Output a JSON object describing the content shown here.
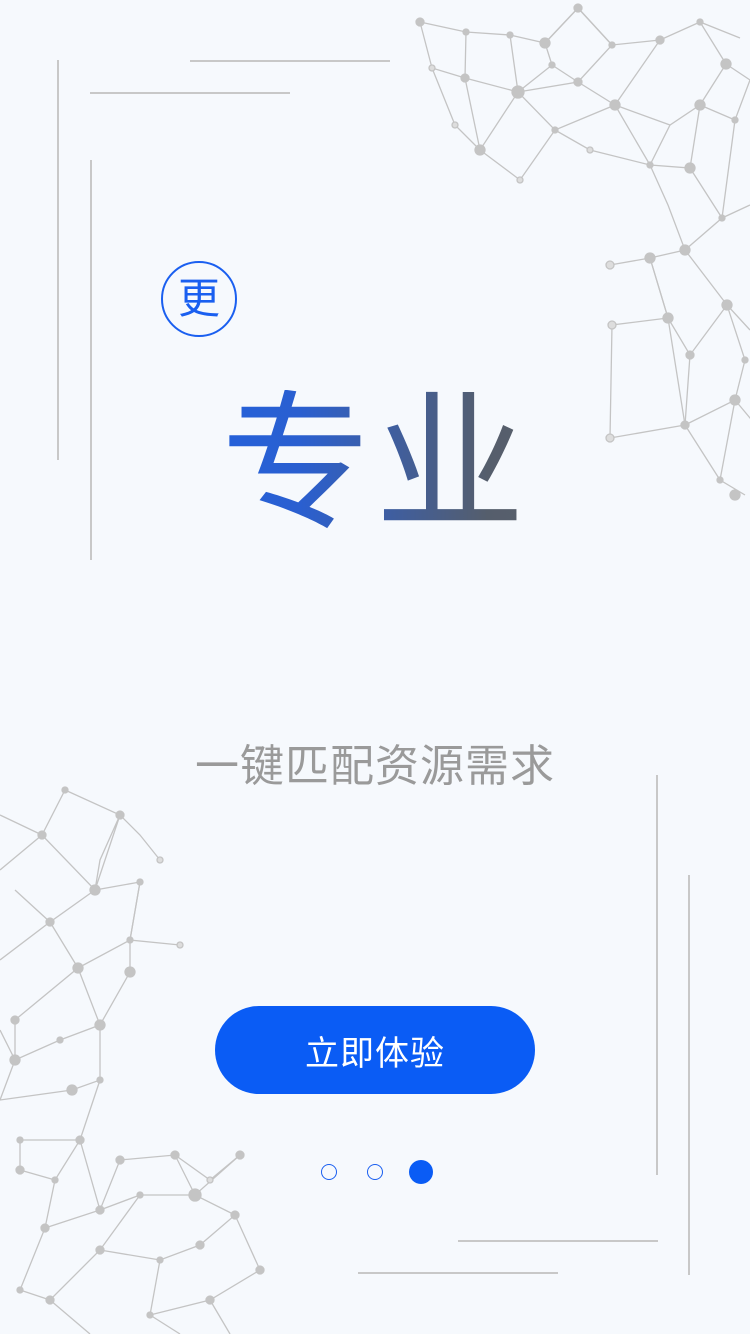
{
  "badge": {
    "char": "更"
  },
  "headline": {
    "text": "专业"
  },
  "subtitle": {
    "text": "一键匹配资源需求"
  },
  "cta": {
    "label": "立即体验"
  },
  "pager": {
    "total": 3,
    "active_index": 3
  },
  "colors": {
    "accent": "#0a5cf5",
    "headline_gradient_start": "#1565f5",
    "headline_gradient_end": "#666666",
    "subtitle": "#9a9a9a",
    "background": "#f6f9fd",
    "frame_lines": "#c8c8c8",
    "network_pattern": "#c4c4c4"
  }
}
